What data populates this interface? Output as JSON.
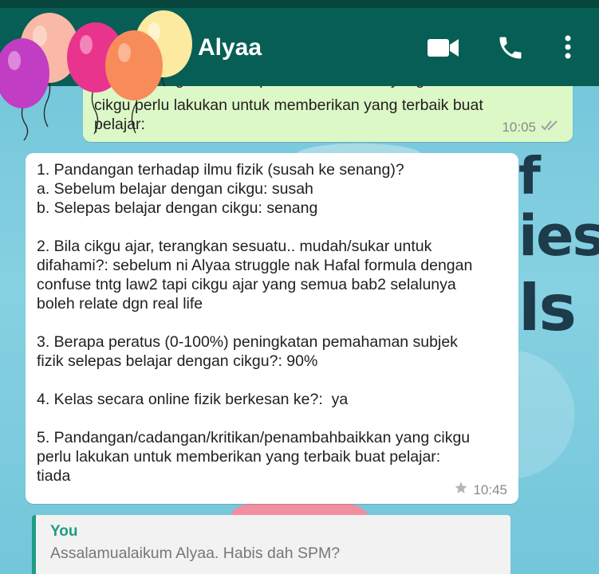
{
  "header": {
    "contact_name": "Alyaa"
  },
  "wallpaper": {
    "text_1": "f",
    "text_2": "ies",
    "text_3": "ls"
  },
  "messages": [
    {
      "type": "outgoing",
      "partial_top": "ngan/cadangan/kritikan/penambahbaikkan yang",
      "text": "cikgu perlu lakukan untuk memberikan yang terbaik buat\npelajar:",
      "time": "10:05"
    },
    {
      "type": "incoming",
      "text": "1. Pandangan terhadap ilmu fizik (susah ke senang)?\na. Sebelum belajar dengan cikgu: susah\nb. Selepas belajar dengan cikgu: senang\n\n2. Bila cikgu ajar, terangkan sesuatu.. mudah/sukar untuk\ndifahami?: sebelum ni Alyaa struggle nak Hafal formula dengan\nconfuse tntg law2 tapi cikgu ajar yang semua bab2 selalunya\nboleh relate dgn real life\n\n3. Berapa peratus (0-100%) peningkatan pemahaman subjek\nfizik selepas belajar dengan cikgu?: 90%\n\n4. Kelas secara online fizik berkesan ke?:  ya\n\n5. Pandangan/cadangan/kritikan/penambahbaikkan yang cikgu\nperlu lakukan untuk memberikan yang terbaik buat pelajar:\ntiada",
      "time": "10:45",
      "starred": true
    }
  ],
  "reply_preview": {
    "sender": "You",
    "text": "Assalamualaikum Alyaa. Habis dah SPM?"
  },
  "colors": {
    "header": "#075e54",
    "outgoing_bubble": "#dcf8c6",
    "incoming_bubble": "#ffffff",
    "reply_accent": "#1e9c85",
    "read_ticks": "#8a8a8a"
  },
  "icons": [
    "video-call-icon",
    "phone-icon",
    "more-options-icon",
    "read-ticks-icon",
    "star-icon",
    "balloon-icon"
  ]
}
